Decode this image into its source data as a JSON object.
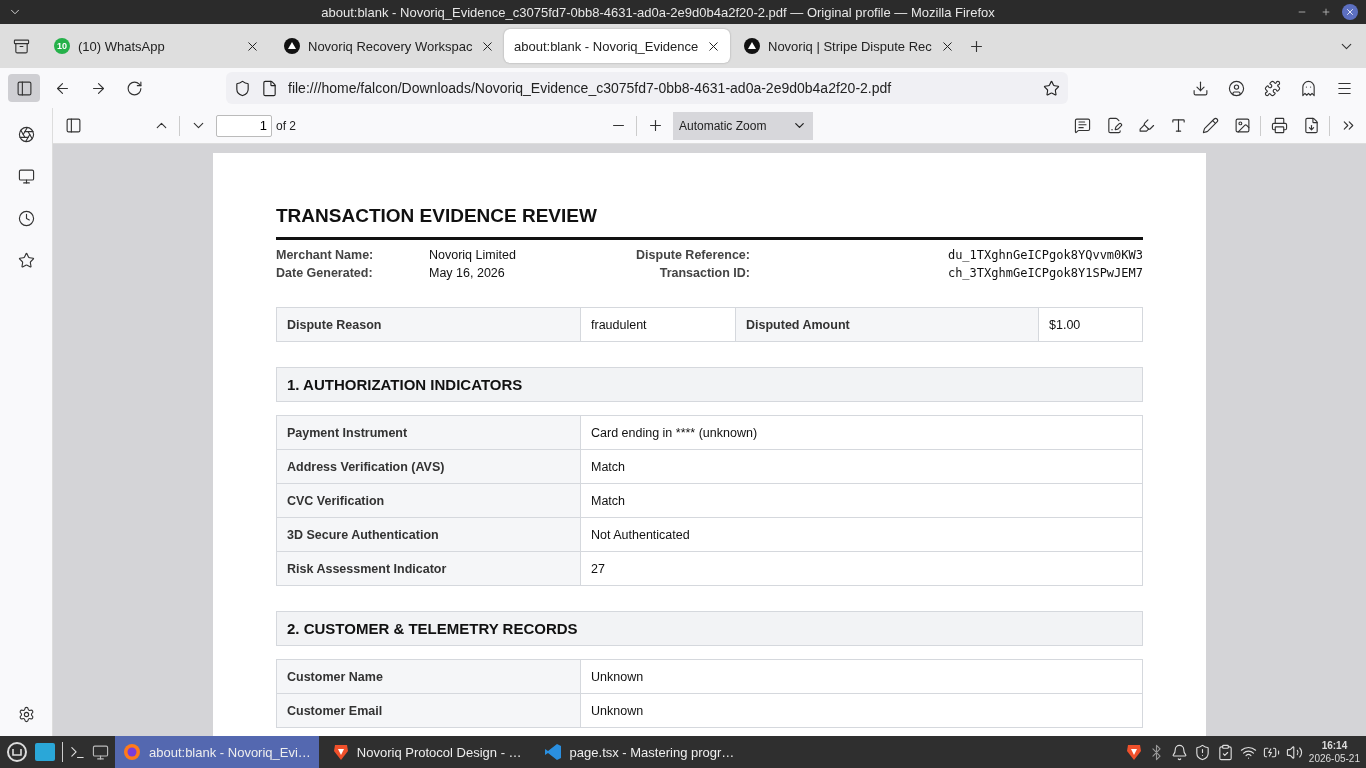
{
  "window": {
    "title": "about:blank - Novoriq_Evidence_c3075fd7-0bb8-4631-ad0a-2e9d0b4a2f20-2.pdf — Original profile — Mozilla Firefox"
  },
  "tabs": [
    {
      "label": "(10) WhatsApp",
      "badge": "10",
      "kind": "whatsapp",
      "selected": false
    },
    {
      "label": "Novoriq Recovery Workspac",
      "kind": "triangle",
      "selected": false
    },
    {
      "label": "about:blank - Novoriq_Evidence",
      "kind": "none",
      "selected": true
    },
    {
      "label": "Novoriq | Stripe Dispute Rec",
      "kind": "triangle",
      "selected": false
    }
  ],
  "address_bar": {
    "url": "file:///home/falcon/Downloads/Novoriq_Evidence_c3075fd7-0bb8-4631-ad0a-2e9d0b4a2f20-2.pdf"
  },
  "pdf_toolbar": {
    "page": "1",
    "page_count": "of 2",
    "zoom": "Automatic Zoom"
  },
  "document": {
    "title": "TRANSACTION EVIDENCE REVIEW",
    "meta": [
      {
        "label": "Merchant Name:",
        "value": "Novoriq Limited",
        "kind": "plain"
      },
      {
        "label": "Dispute Reference:",
        "value": "du_1TXghnGeICPgok8YQvvm0KW3",
        "kind": "mono"
      },
      {
        "label": "Date Generated:",
        "value": "May 16, 2026",
        "kind": "plain"
      },
      {
        "label": "Transaction ID:",
        "value": "ch_3TXghmGeICPgok8Y1SPwJEM7",
        "kind": "mono"
      }
    ],
    "summary": [
      {
        "label": "Dispute Reason",
        "value": "fraudulent"
      },
      {
        "label": "Disputed Amount",
        "value": "$1.00"
      }
    ],
    "sections": [
      {
        "heading": "1. AUTHORIZATION INDICATORS",
        "rows": [
          {
            "label": "Payment Instrument",
            "value": "Card ending in **** (unknown)"
          },
          {
            "label": "Address Verification (AVS)",
            "value": "Match"
          },
          {
            "label": "CVC Verification",
            "value": "Match"
          },
          {
            "label": "3D Secure Authentication",
            "value": "Not Authenticated"
          },
          {
            "label": "Risk Assessment Indicator",
            "value": "27"
          }
        ]
      },
      {
        "heading": "2. CUSTOMER & TELEMETRY RECORDS",
        "rows": [
          {
            "label": "Customer Name",
            "value": "Unknown"
          },
          {
            "label": "Customer Email",
            "value": "Unknown"
          }
        ]
      }
    ]
  },
  "taskbar": {
    "items": [
      {
        "label": "about:blank - Novoriq_Evi…",
        "kind": "firefox",
        "selected": true
      },
      {
        "label": "Novoriq Protocol Design - …",
        "kind": "brave",
        "selected": false
      },
      {
        "label": "page.tsx - Mastering progr…",
        "kind": "vscode",
        "selected": false
      }
    ],
    "time": "16:14",
    "date": "2026-05-21"
  }
}
